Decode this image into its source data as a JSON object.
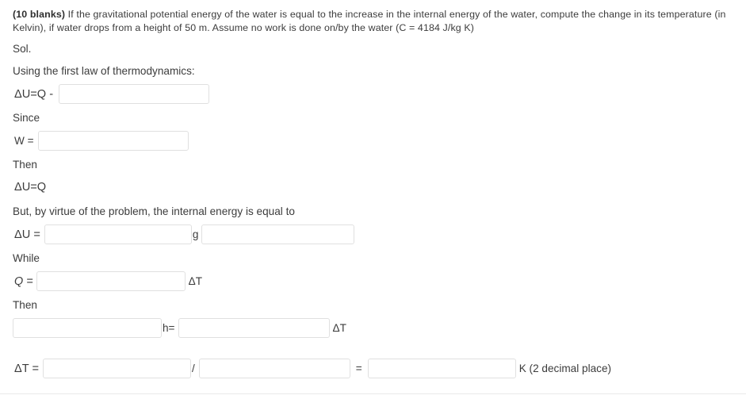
{
  "problem": {
    "blanks_tag": "(10 blanks)",
    "text": " If the gravitational potential energy of the water is equal to the increase in the internal energy of the water, compute the change in its temperature (in Kelvin), if water drops from a height of 50 m. Assume no work is done on/by the water (C = 4184 J/kg K)"
  },
  "solution": {
    "sol_label": "Sol.",
    "first_law_label": "Using the first law of thermodynamics:",
    "du_q_minus_label": "ΔU=Q -",
    "since_label": "Since",
    "w_label": "W =",
    "then_label_1": "Then",
    "du_eq_q_label": "ΔU=Q",
    "virtue_label": "But, by virtue of the problem, the internal energy is equal to",
    "du_label": "ΔU =",
    "g_label": "g",
    "while_label": "While",
    "q_label": "Q =",
    "delta_t_label": "ΔT",
    "then_label_2": "Then",
    "h_label": "h=",
    "delta_t_label_2": "ΔT",
    "final_delta_t_label": "ΔT =",
    "divide_label": "/",
    "equals_label": "=",
    "result_unit_label": "K (2 decimal place)"
  },
  "blanks": {
    "du_q_minus_value": "",
    "w_value": "",
    "du_left_value": "",
    "du_right_value": "",
    "q_value": "",
    "h_left_value": "",
    "h_right_value": "",
    "final_numerator_value": "",
    "final_denominator_value": "",
    "final_result_value": "",
    "placeholder": ""
  },
  "colors": {
    "text": "#3c3c3c",
    "border": "#e0e0e0",
    "background": "#ffffff",
    "divider": "#e9e9e9"
  }
}
